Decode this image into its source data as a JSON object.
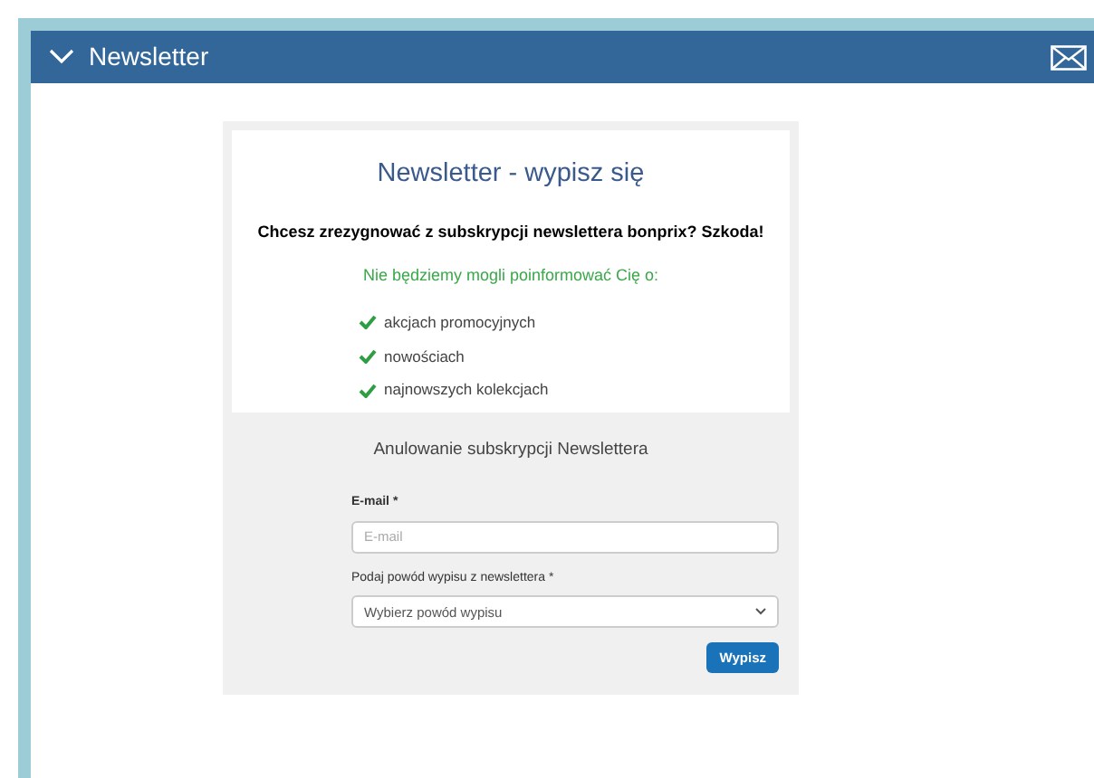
{
  "panel": {
    "title": "Newsletter",
    "expanded": true
  },
  "card": {
    "heading": "Newsletter - wypisz się",
    "question": "Chcesz zrezygnować z subskrypcji newslettera bonprix? Szkoda!",
    "notice": "Nie będziemy mogli poinformować Cię o:",
    "benefits": [
      "akcjach promocyjnych",
      "nowościach",
      "najnowszych kolekcjach"
    ]
  },
  "form": {
    "title": "Anulowanie subskrypcji Newslettera",
    "email_label": "E-mail *",
    "email_placeholder": "E-mail",
    "reason_label": "Podaj powód wypisu z newslettera *",
    "reason_value": "Wybierz powód wypisu",
    "submit": "Wypisz"
  }
}
